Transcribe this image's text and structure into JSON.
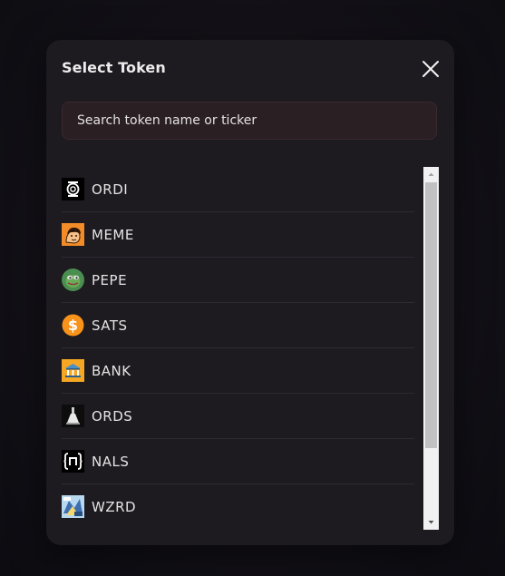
{
  "modal": {
    "title": "Select Token",
    "close_icon": "close-icon"
  },
  "search": {
    "placeholder": "Search token name or ticker",
    "value": ""
  },
  "tokens": [
    {
      "ticker": "ORDI",
      "icon": "ordi-icon"
    },
    {
      "ticker": "MEME",
      "icon": "meme-icon"
    },
    {
      "ticker": "PEPE",
      "icon": "pepe-icon"
    },
    {
      "ticker": "SATS",
      "icon": "sats-icon"
    },
    {
      "ticker": "BANK",
      "icon": "bank-icon"
    },
    {
      "ticker": "ORDS",
      "icon": "ords-icon"
    },
    {
      "ticker": "NALS",
      "icon": "nals-icon"
    },
    {
      "ticker": "WZRD",
      "icon": "wzrd-icon"
    }
  ],
  "colors": {
    "modal_bg": "#1d1a20",
    "search_bg": "#2a1f23",
    "text": "#e4e4e4",
    "sats_orange": "#f7931a",
    "meme_orange": "#f28c28",
    "pepe_green": "#4a8f4f"
  }
}
